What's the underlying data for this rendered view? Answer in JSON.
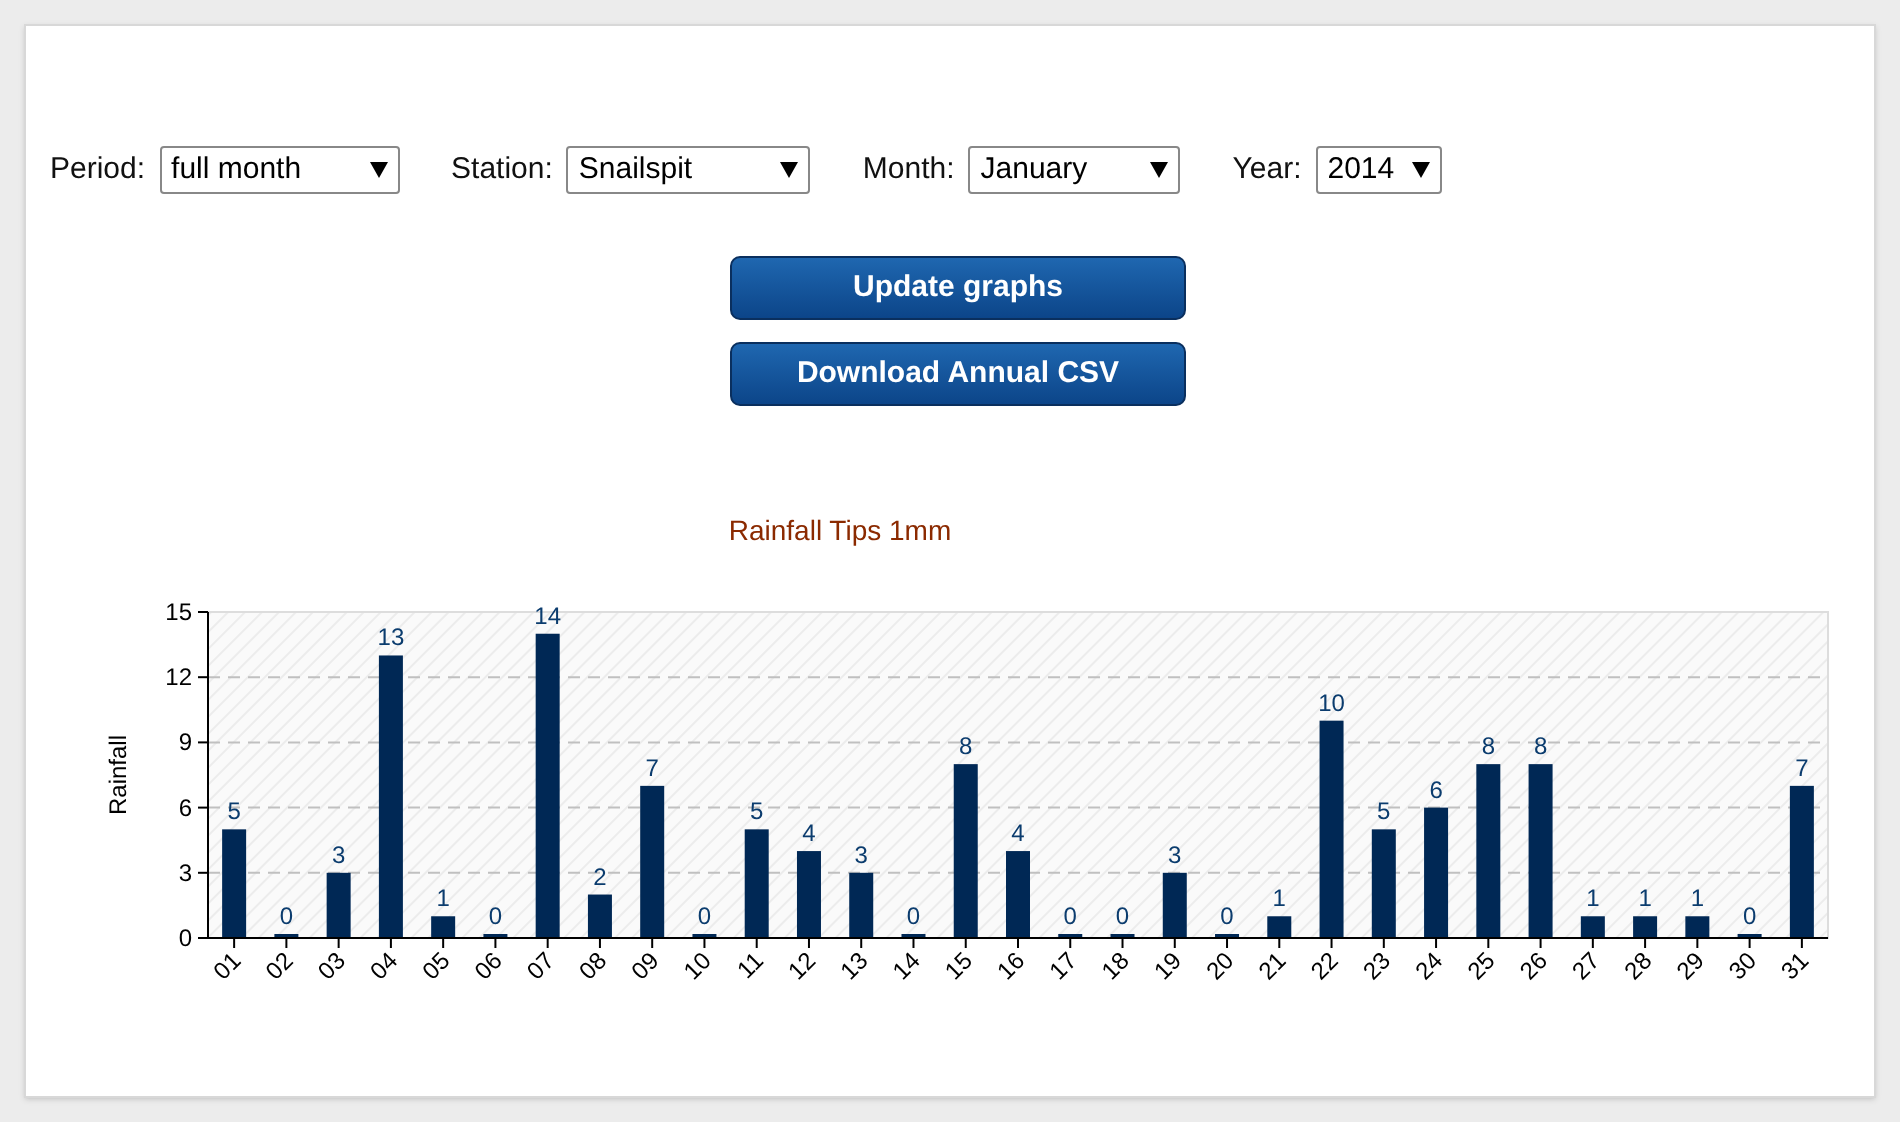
{
  "filters": [
    {
      "label": "Period:",
      "value": "full month"
    },
    {
      "label": "Station:",
      "value": "Snailspit"
    },
    {
      "label": "Month:",
      "value": "January"
    },
    {
      "label": "Year:",
      "value": "2014"
    }
  ],
  "buttons": [
    "Update graphs",
    "Download Annual CSV"
  ],
  "chart": {
    "chart_data": {
      "type": "bar",
      "title": "Rainfall Tips 1mm",
      "ylabel": "Rainfall",
      "categories": [
        "01",
        "02",
        "03",
        "04",
        "05",
        "06",
        "07",
        "08",
        "09",
        "10",
        "11",
        "12",
        "13",
        "14",
        "15",
        "16",
        "17",
        "18",
        "19",
        "20",
        "21",
        "22",
        "23",
        "24",
        "25",
        "26",
        "27",
        "28",
        "29",
        "30",
        "31"
      ],
      "series": [
        {
          "color": "#002855",
          "values": [
            5,
            0,
            3,
            13,
            1,
            0,
            14,
            2,
            7,
            0,
            5,
            4,
            3,
            0,
            8,
            4,
            0,
            0,
            3,
            0,
            1,
            10,
            5,
            6,
            8,
            8,
            1,
            1,
            1,
            0,
            7
          ]
        }
      ],
      "ylim": [
        0,
        15
      ],
      "yticks": [
        0,
        3,
        6,
        9,
        12,
        15
      ],
      "data_labels": true,
      "grid": true
    }
  }
}
